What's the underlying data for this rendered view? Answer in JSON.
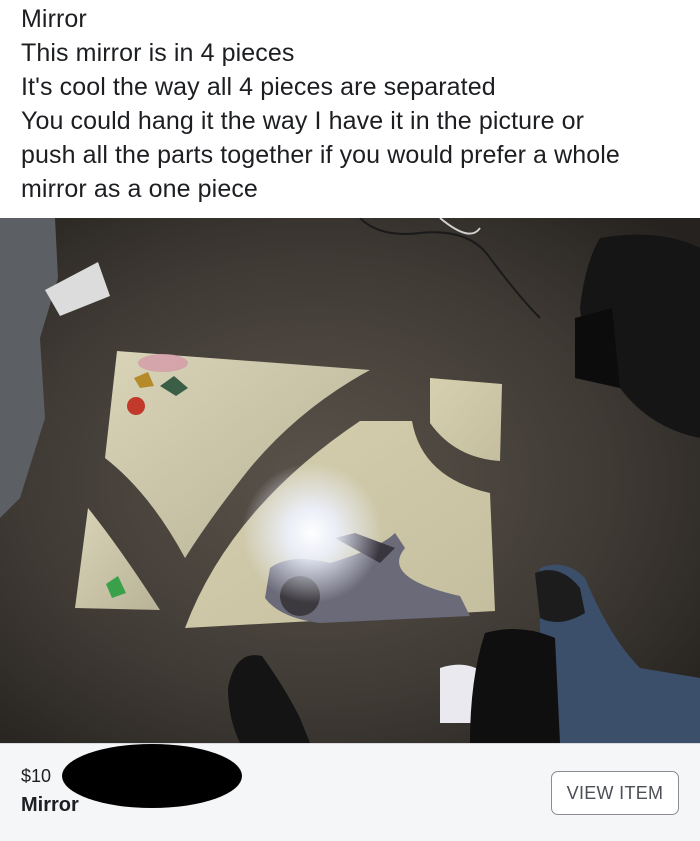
{
  "post": {
    "lines": [
      "Mirror",
      "This mirror is in 4 pieces",
      "It's cool the way all 4 pieces are separated",
      "You could hang it the way I have it in the picture or",
      "push all the parts together if you would prefer a whole",
      "mirror as a one piece"
    ]
  },
  "listing": {
    "price": "$10",
    "title": "Mirror",
    "button_label": "VIEW ITEM"
  },
  "colors": {
    "post_background": "#ffffff",
    "listing_background": "#f4f6f8",
    "button_border": "#8a8d91",
    "redaction": "#000000"
  }
}
